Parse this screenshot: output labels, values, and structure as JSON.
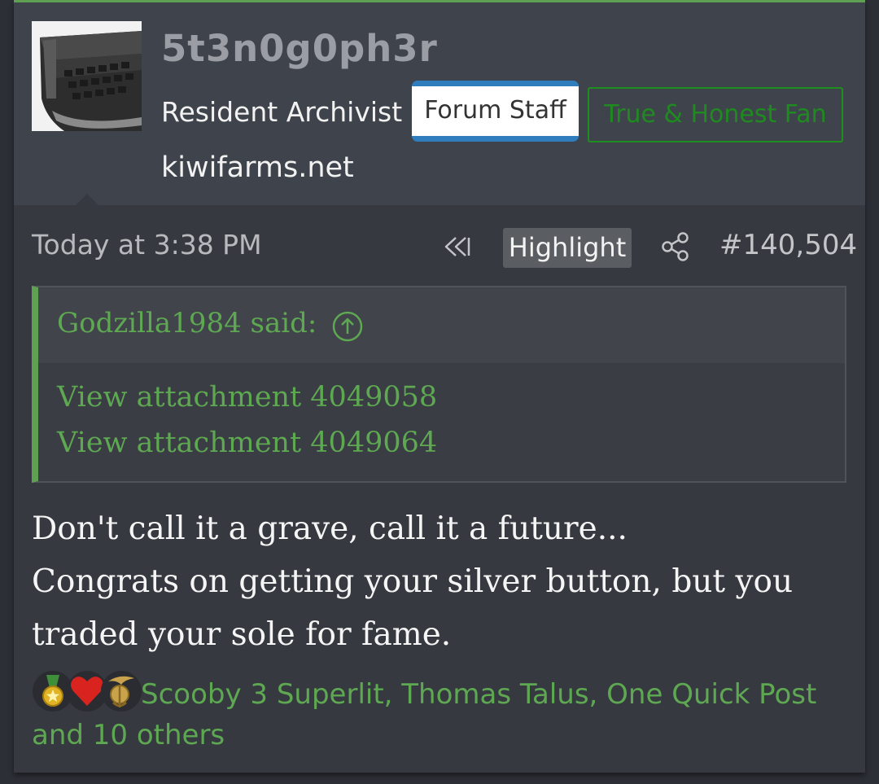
{
  "user": {
    "username": "5t3n0g0ph3r",
    "title": "Resident Archivist",
    "banners": [
      "Forum Staff",
      "True & Honest Fan"
    ],
    "site": "kiwifarms.net",
    "avatar": "typewriter-avatar"
  },
  "post": {
    "timestamp": "Today at 3:38 PM",
    "highlight_label": "Highlight",
    "post_number": "#140,504",
    "icons": [
      "rewind-icon",
      "share-icon"
    ]
  },
  "quote": {
    "author": "Godzilla1984 said:",
    "icon": "arrow-up-circle-icon",
    "attachments": [
      "View attachment 4049058",
      "View attachment 4049064"
    ]
  },
  "body": {
    "lines": [
      "Don't call it a grave, call it a future...",
      "Congrats on getting your silver button, but you",
      "traded your sole for fame."
    ]
  },
  "reactions": {
    "icons": [
      "medal-icon",
      "heart-icon",
      "globe-eagle-anchor-icon"
    ],
    "text": "Scooby 3 Superlit, Thomas Talus, One Quick Post and 10 others"
  },
  "colors": {
    "accent_green": "#5fa052",
    "staff_blue": "#2f7dbd",
    "fan_green": "#1f8a1f",
    "background": "#363940"
  }
}
